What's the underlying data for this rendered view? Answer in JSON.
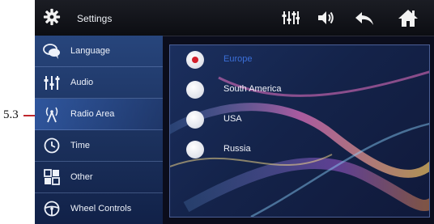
{
  "callout": {
    "label": "5.3"
  },
  "header": {
    "title": "Settings",
    "icons": [
      "gear-icon",
      "equalizer-icon",
      "volume-icon",
      "back-arrow-icon",
      "home-icon"
    ]
  },
  "sidebar": {
    "items": [
      {
        "label": "Language",
        "icon": "speech-bubble-icon"
      },
      {
        "label": "Audio",
        "icon": "equalizer-icon"
      },
      {
        "label": "Radio Area",
        "icon": "antenna-icon",
        "active": true
      },
      {
        "label": "Time",
        "icon": "clock-icon"
      },
      {
        "label": "Other",
        "icon": "grid-icon"
      },
      {
        "label": "Wheel Controls",
        "icon": "steering-wheel-icon"
      }
    ]
  },
  "content": {
    "options": [
      {
        "label": "Europe",
        "selected": true
      },
      {
        "label": "South America",
        "selected": false
      },
      {
        "label": "USA",
        "selected": false
      },
      {
        "label": "Russia",
        "selected": false
      }
    ]
  },
  "colors": {
    "accent": "#3b6fd8",
    "radio_selected": "#d21f2b",
    "callout": "#c0272d"
  }
}
